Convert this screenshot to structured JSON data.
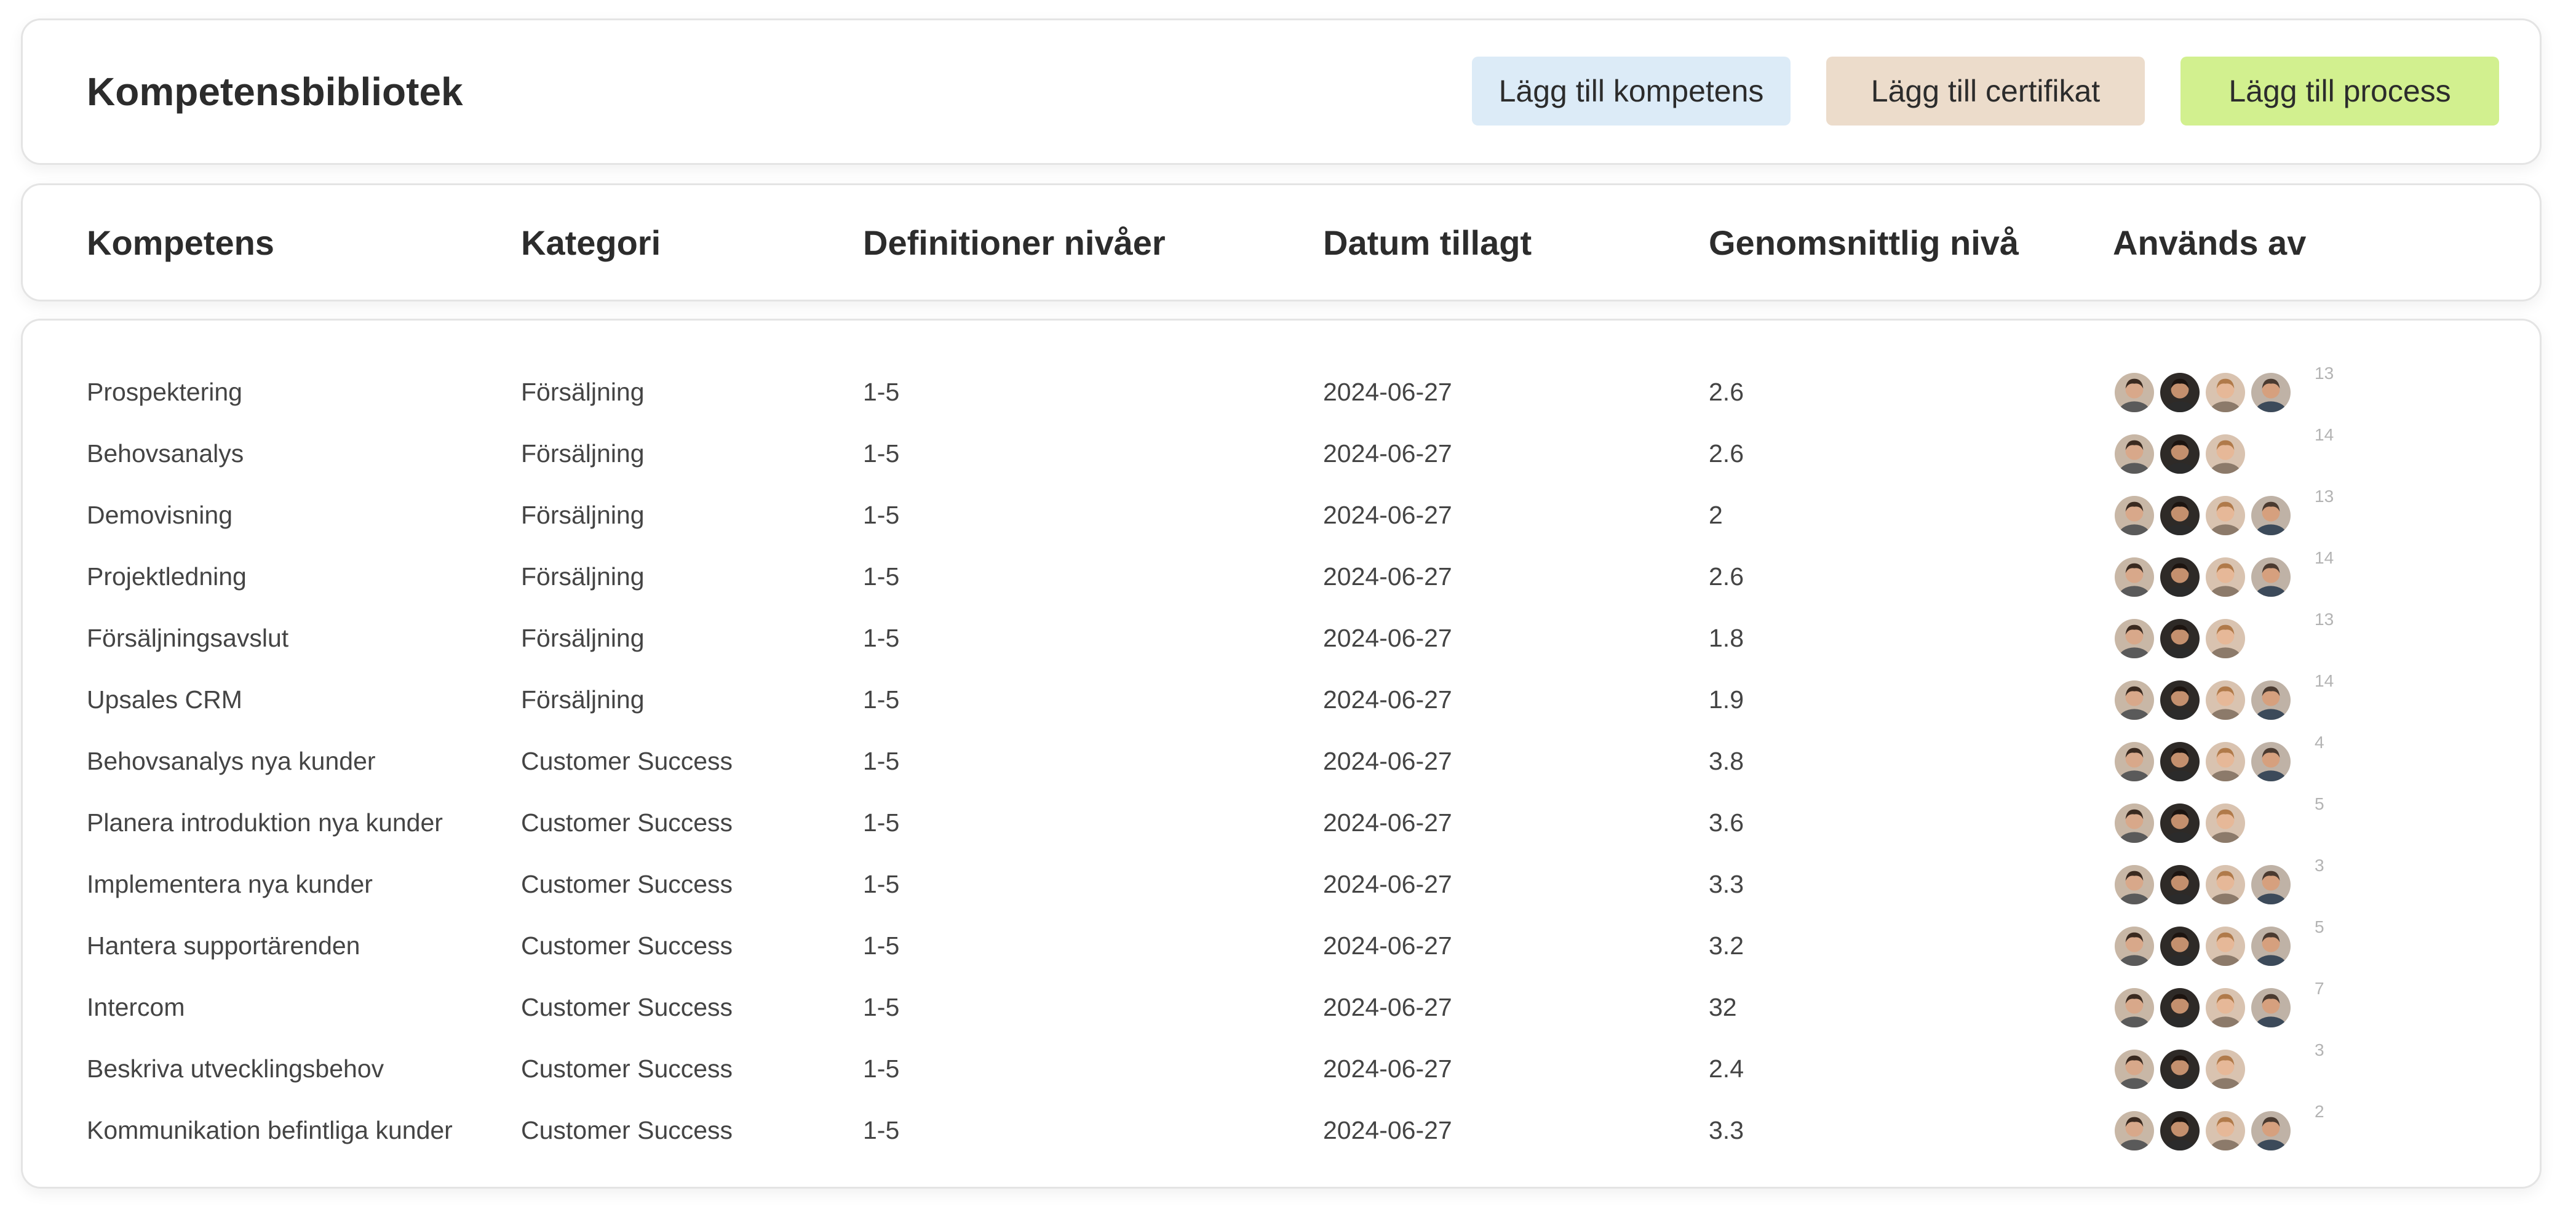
{
  "header": {
    "title": "Kompetensbibliotek",
    "buttons": {
      "add_competence": "Lägg till kompetens",
      "add_certificate": "Lägg till certifikat",
      "add_process": "Lägg till process"
    }
  },
  "columns": [
    "Kompetens",
    "Kategori",
    "Definitioner nivåer",
    "Datum tillagt",
    "Genomsnittlig nivå",
    "Används av"
  ],
  "colors": {
    "add_competence_bg": "#dcebf7",
    "add_certificate_bg": "#ecdccb",
    "add_process_bg": "#d2f08f"
  },
  "rows": [
    {
      "name": "Prospektering",
      "category": "Försäljning",
      "levels": "1-5",
      "date": "2024-06-27",
      "avg": "2.6",
      "count": "13",
      "avatars": 4
    },
    {
      "name": "Behovsanalys",
      "category": "Försäljning",
      "levels": "1-5",
      "date": "2024-06-27",
      "avg": "2.6",
      "count": "14",
      "avatars": 3
    },
    {
      "name": "Demovisning",
      "category": "Försäljning",
      "levels": "1-5",
      "date": "2024-06-27",
      "avg": "2",
      "count": "13",
      "avatars": 4
    },
    {
      "name": "Projektledning",
      "category": "Försäljning",
      "levels": "1-5",
      "date": "2024-06-27",
      "avg": "2.6",
      "count": "14",
      "avatars": 4
    },
    {
      "name": "Försäljningsavslut",
      "category": "Försäljning",
      "levels": "1-5",
      "date": "2024-06-27",
      "avg": "1.8",
      "count": "13",
      "avatars": 3
    },
    {
      "name": "Upsales CRM",
      "category": "Försäljning",
      "levels": "1-5",
      "date": "2024-06-27",
      "avg": "1.9",
      "count": "14",
      "avatars": 4
    },
    {
      "name": "Behovsanalys nya kunder",
      "category": "Customer Success",
      "levels": "1-5",
      "date": "2024-06-27",
      "avg": "3.8",
      "count": "4",
      "avatars": 4
    },
    {
      "name": "Planera introduktion nya kunder",
      "category": "Customer Success",
      "levels": "1-5",
      "date": "2024-06-27",
      "avg": "3.6",
      "count": "5",
      "avatars": 3
    },
    {
      "name": "Implementera nya kunder",
      "category": "Customer Success",
      "levels": "1-5",
      "date": "2024-06-27",
      "avg": "3.3",
      "count": "3",
      "avatars": 4
    },
    {
      "name": "Hantera supportärenden",
      "category": "Customer Success",
      "levels": "1-5",
      "date": "2024-06-27",
      "avg": "3.2",
      "count": "5",
      "avatars": 4
    },
    {
      "name": "Intercom",
      "category": "Customer Success",
      "levels": "1-5",
      "date": "2024-06-27",
      "avg": "32",
      "count": "7",
      "avatars": 4
    },
    {
      "name": "Beskriva utvecklingsbehov",
      "category": "Customer Success",
      "levels": "1-5",
      "date": "2024-06-27",
      "avg": "2.4",
      "count": "3",
      "avatars": 3
    },
    {
      "name": "Kommunikation befintliga kunder",
      "category": "Customer Success",
      "levels": "1-5",
      "date": "2024-06-27",
      "avg": "3.3",
      "count": "2",
      "avatars": 4
    }
  ]
}
